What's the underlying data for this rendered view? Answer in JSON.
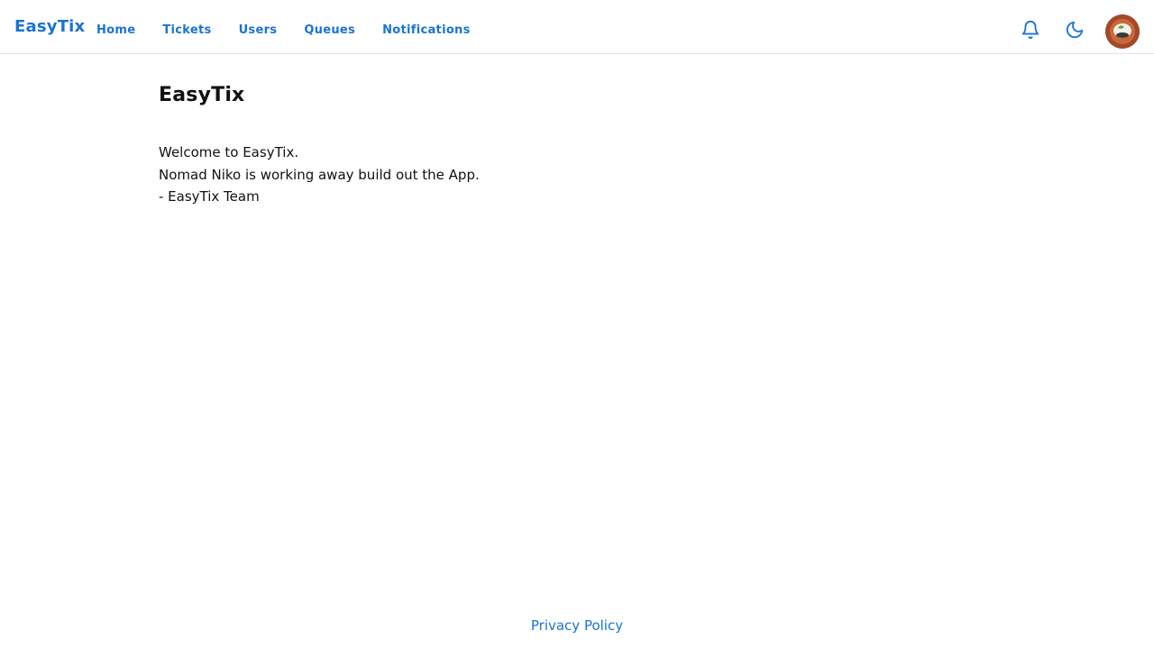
{
  "colors": {
    "accent": "#1a73d4",
    "text": "#111111",
    "border": "#e2e2e2",
    "background": "#ffffff"
  },
  "header": {
    "brand": "EasyTix",
    "nav": [
      {
        "label": "Home"
      },
      {
        "label": "Tickets"
      },
      {
        "label": "Users"
      },
      {
        "label": "Queues"
      },
      {
        "label": "Notifications"
      }
    ],
    "icons": [
      "bell-icon",
      "moon-icon",
      "avatar"
    ]
  },
  "main": {
    "title": "EasyTix",
    "lines": [
      "Welcome to EasyTix.",
      "Nomad Niko is working away build out the App.",
      "- EasyTix Team"
    ]
  },
  "footer": {
    "privacy_label": "Privacy Policy"
  }
}
